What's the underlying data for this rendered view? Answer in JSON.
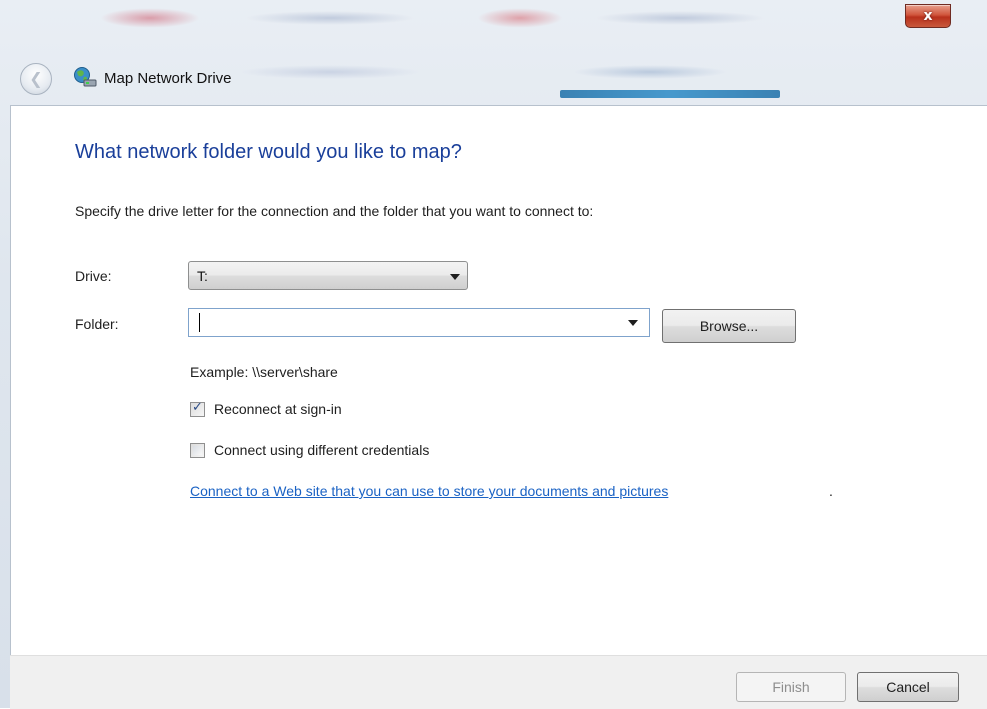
{
  "window": {
    "title": "Map Network Drive",
    "close_glyph": "x",
    "back_glyph": "❮"
  },
  "main": {
    "heading": "What network folder would you like to map?",
    "instructions": "Specify the drive letter for the connection and the folder that you want to connect to:",
    "drive": {
      "label": "Drive:",
      "value": "T:"
    },
    "folder": {
      "label": "Folder:",
      "value": "",
      "browse_label": "Browse..."
    },
    "example": "Example: \\\\server\\share",
    "reconnect": {
      "label": "Reconnect at sign-in",
      "checked": true
    },
    "credentials": {
      "label": "Connect using different credentials",
      "checked": false
    },
    "web_link": "Connect to a Web site that you can use to store your documents and pictures",
    "web_link_suffix": "."
  },
  "footer": {
    "finish_label": "Finish",
    "cancel_label": "Cancel"
  },
  "icons": {
    "title": "map-network-drive-icon",
    "back": "back-arrow-icon",
    "close": "close-icon",
    "dropdown": "dropdown-arrow-icon",
    "check": "check-icon"
  },
  "colors": {
    "heading": "#1a3f9a",
    "link": "#1a62c4",
    "close_button": "#c8452e",
    "disabled_text": "#8d8d8d"
  }
}
